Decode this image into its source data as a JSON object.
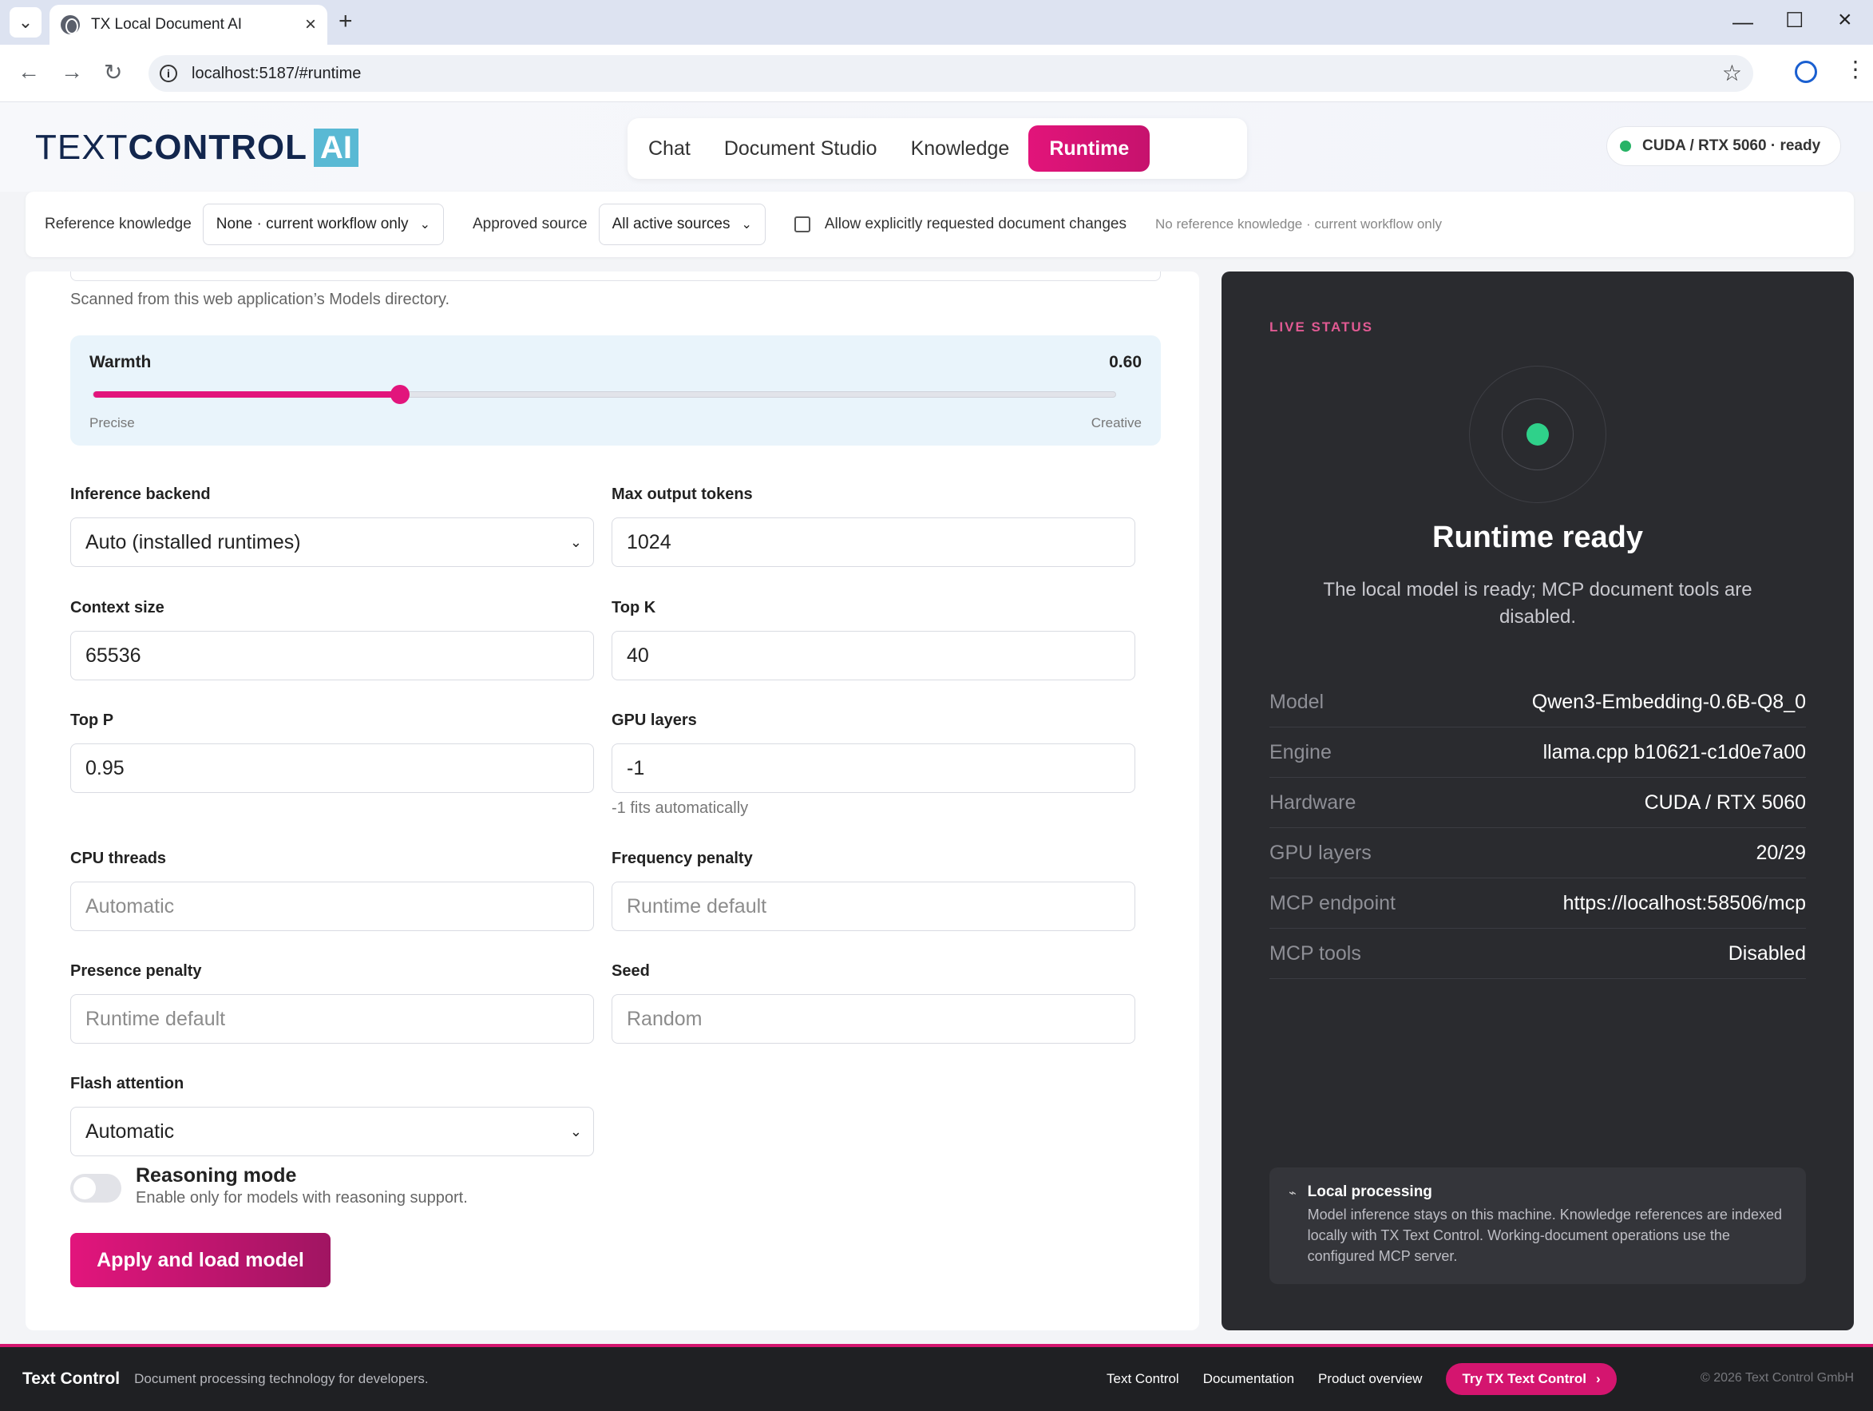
{
  "browser": {
    "tab_title": "TX Local Document AI",
    "url": "localhost:5187/#runtime"
  },
  "header": {
    "logo_text_a": "TEXT",
    "logo_text_b": "CONTROL",
    "logo_ai": "AI",
    "nav": [
      "Chat",
      "Document Studio",
      "Knowledge",
      "Runtime"
    ],
    "active_nav": "Runtime",
    "gpu_status": "CUDA / RTX 5060 · ready"
  },
  "filters": {
    "reference_label": "Reference knowledge",
    "reference_value": "None · current workflow only",
    "approved_label": "Approved source",
    "approved_value": "All active sources",
    "allow_changes_label": "Allow explicitly requested document changes",
    "note": "No reference knowledge · current workflow only"
  },
  "settings": {
    "scan_note": "Scanned from this web application’s Models directory.",
    "warmth": {
      "label": "Warmth",
      "value_text": "0.60",
      "value": 0.6,
      "low_label": "Precise",
      "high_label": "Creative"
    },
    "fields": {
      "inference_backend": {
        "label": "Inference backend",
        "value": "Auto (installed runtimes)"
      },
      "max_output_tokens": {
        "label": "Max output tokens",
        "value": "1024"
      },
      "context_size": {
        "label": "Context size",
        "value": "65536"
      },
      "top_k": {
        "label": "Top K",
        "value": "40"
      },
      "top_p": {
        "label": "Top P",
        "value": "0.95"
      },
      "gpu_layers": {
        "label": "GPU layers",
        "value": "-1",
        "hint": "-1 fits automatically"
      },
      "cpu_threads": {
        "label": "CPU threads",
        "placeholder": "Automatic"
      },
      "frequency_penalty": {
        "label": "Frequency penalty",
        "placeholder": "Runtime default"
      },
      "presence_penalty": {
        "label": "Presence penalty",
        "placeholder": "Runtime default"
      },
      "seed": {
        "label": "Seed",
        "placeholder": "Random"
      },
      "flash_attention": {
        "label": "Flash attention",
        "value": "Automatic"
      }
    },
    "reasoning": {
      "title": "Reasoning mode",
      "subtitle": "Enable only for models with reasoning support.",
      "enabled": false
    },
    "apply_button": "Apply and load model"
  },
  "live_status": {
    "label": "LIVE STATUS",
    "title": "Runtime ready",
    "description": "The local model is ready; MCP document tools are disabled.",
    "rows": [
      {
        "key": "Model",
        "value": "Qwen3-Embedding-0.6B-Q8_0"
      },
      {
        "key": "Engine",
        "value": "llama.cpp b10621-c1d0e7a00"
      },
      {
        "key": "Hardware",
        "value": "CUDA / RTX 5060"
      },
      {
        "key": "GPU layers",
        "value": "20/29"
      },
      {
        "key": "MCP endpoint",
        "value": "https://localhost:58506/mcp"
      },
      {
        "key": "MCP tools",
        "value": "Disabled"
      }
    ],
    "local": {
      "title": "Local processing",
      "text": "Model inference stays on this machine. Knowledge references are indexed locally with TX Text Control. Working-document operations use the configured MCP server."
    }
  },
  "footer": {
    "brand": "Text Control",
    "tagline": "Document processing technology for developers.",
    "links": [
      "Text Control",
      "Documentation",
      "Product overview"
    ],
    "cta": "Try TX Text Control",
    "copyright": "© 2026 Text Control GmbH"
  },
  "colors": {
    "accent": "#e2157c",
    "ready": "#2fd18a",
    "dark_panel": "#2a2b2f"
  }
}
